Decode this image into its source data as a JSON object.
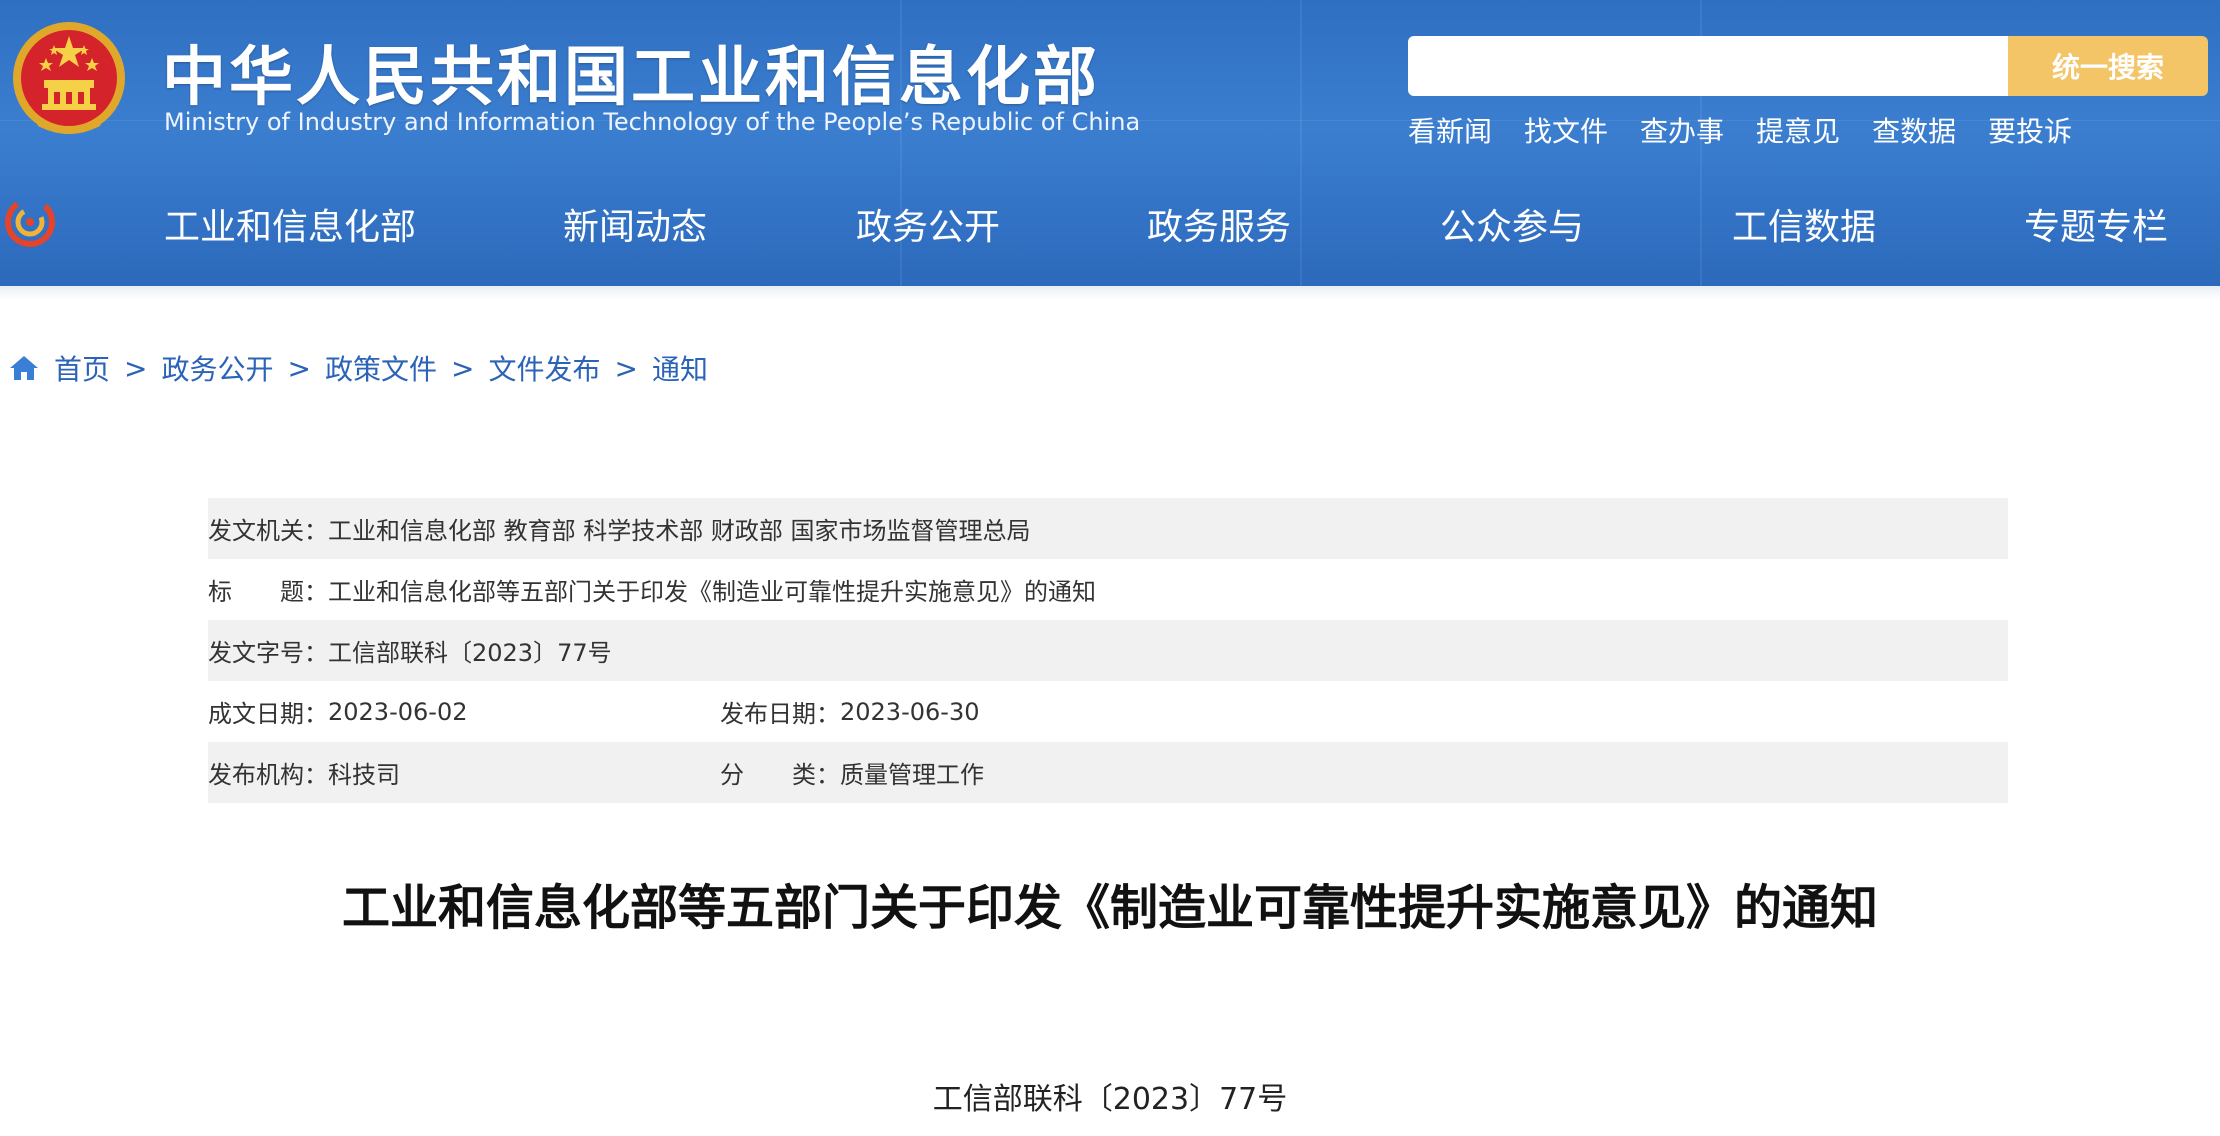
{
  "header": {
    "title_cn": "中华人民共和国工业和信息化部",
    "title_en": "Ministry of Industry and Information Technology of the People’s Republic of China",
    "background_color": "#2f6fc1",
    "search": {
      "placeholder": "",
      "button_label": "统一搜索",
      "button_color": "#f3c567"
    },
    "quick_links": [
      "看新闻",
      "找文件",
      "查办事",
      "提意见",
      "查数据",
      "要投诉"
    ],
    "nav": [
      "工业和信息化部",
      "新闻动态",
      "政务公开",
      "政务服务",
      "公众参与",
      "工信数据",
      "专题专栏"
    ]
  },
  "breadcrumb": {
    "home": "首页",
    "items": [
      "政务公开",
      "政策文件",
      "文件发布",
      "通知"
    ],
    "separator": ">",
    "link_color": "#2b63b8"
  },
  "info": {
    "issuer_label": "发文机关：",
    "issuer_value": "工业和信息化部 教育部 科学技术部 财政部 国家市场监督管理总局",
    "title_label": "标　　题：",
    "title_value": "工业和信息化部等五部门关于印发《制造业可靠性提升实施意见》的通知",
    "docno_label": "发文字号：",
    "docno_value": "工信部联科〔2023〕77号",
    "written_label": "成文日期：",
    "written_value": "2023-06-02",
    "published_label": "发布日期：",
    "published_value": "2023-06-30",
    "org_label": "发布机构：",
    "org_value": "科技司",
    "category_label": "分　　类：",
    "category_value": "质量管理工作"
  },
  "article": {
    "title": "工业和信息化部等五部门关于印发《制造业可靠性提升实施意见》的通知",
    "doc_number": "工信部联科〔2023〕77号"
  }
}
